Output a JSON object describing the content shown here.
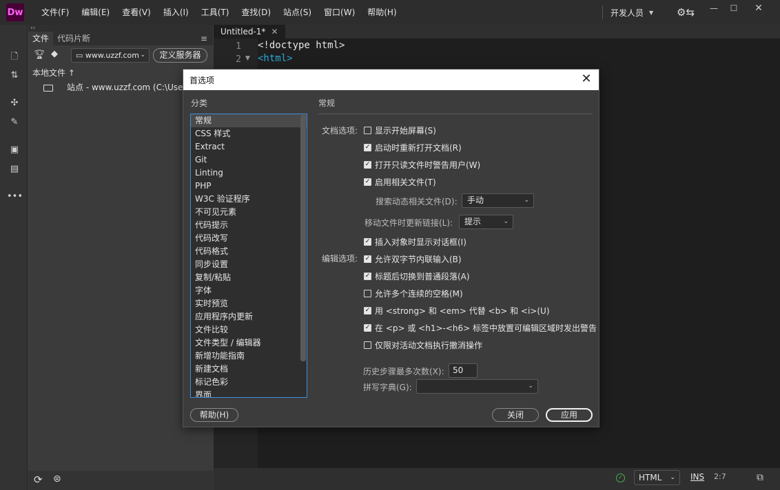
{
  "app": {
    "logo": "Dw"
  },
  "menu": [
    "文件(F)",
    "编辑(E)",
    "查看(V)",
    "插入(I)",
    "工具(T)",
    "查找(D)",
    "站点(S)",
    "窗口(W)",
    "帮助(H)"
  ],
  "workspace": {
    "label": "开发人员"
  },
  "files_panel": {
    "tabs": [
      "文件",
      "代码片断"
    ],
    "site_name": "www.uzzf.com",
    "define_server": "定义服务器",
    "local_files_header": "本地文件 ↑",
    "site_row": "站点 - www.uzzf.com (C:\\Users\\d"
  },
  "editor": {
    "tab_title": "Untitled-1*",
    "lines": [
      {
        "num": "1",
        "text": "<!doctype html>"
      },
      {
        "num": "2",
        "text": "<html>"
      }
    ]
  },
  "status": {
    "language": "HTML",
    "ins": "INS",
    "cursor": "2:7"
  },
  "dialog": {
    "title": "首选项",
    "category_label": "分类",
    "section_title": "常规",
    "categories": [
      "常规",
      "CSS 样式",
      "Extract",
      "Git",
      "Linting",
      "PHP",
      "W3C 验证程序",
      "不可见元素",
      "代码提示",
      "代码改写",
      "代码格式",
      "同步设置",
      "复制/粘贴",
      "字体",
      "实时预览",
      "应用程序内更新",
      "文件比较",
      "文件类型 / 编辑器",
      "新增功能指南",
      "新建文档",
      "标记色彩",
      "界面"
    ],
    "doc_options_label": "文档选项:",
    "edit_options_label": "编辑选项:",
    "doc_options": [
      {
        "label": "显示开始屏幕(S)",
        "checked": false
      },
      {
        "label": "启动时重新打开文档(R)",
        "checked": true
      },
      {
        "label": "打开只读文件时警告用户(W)",
        "checked": true
      },
      {
        "label": "启用相关文件(T)",
        "checked": true
      }
    ],
    "search_related_label": "搜索动态相关文件(D):",
    "search_related_value": "手动",
    "update_links_label": "移动文件时更新链接(L):",
    "update_links_value": "提示",
    "edit_options": [
      {
        "label": "插入对象时显示对话框(I)",
        "checked": true
      },
      {
        "label": "允许双字节内联输入(B)",
        "checked": true
      },
      {
        "label": "标题后切换到普通段落(A)",
        "checked": true
      },
      {
        "label": "允许多个连续的空格(M)",
        "checked": false
      },
      {
        "label": "用 <strong> 和 <em> 代替 <b> 和 <i>(U)",
        "checked": true
      },
      {
        "label": "在 <p> 或 <h1>-<h6> 标签中放置可编辑区域时发出警告",
        "checked": true
      },
      {
        "label": "仅限对活动文档执行撤消操作",
        "checked": false
      }
    ],
    "history_label": "历史步骤最多次数(X):",
    "history_value": "50",
    "spell_label": "拼写字典(G):",
    "spell_value": "",
    "help_button": "帮助(H)",
    "close_button": "关闭",
    "apply_button": "应用"
  }
}
